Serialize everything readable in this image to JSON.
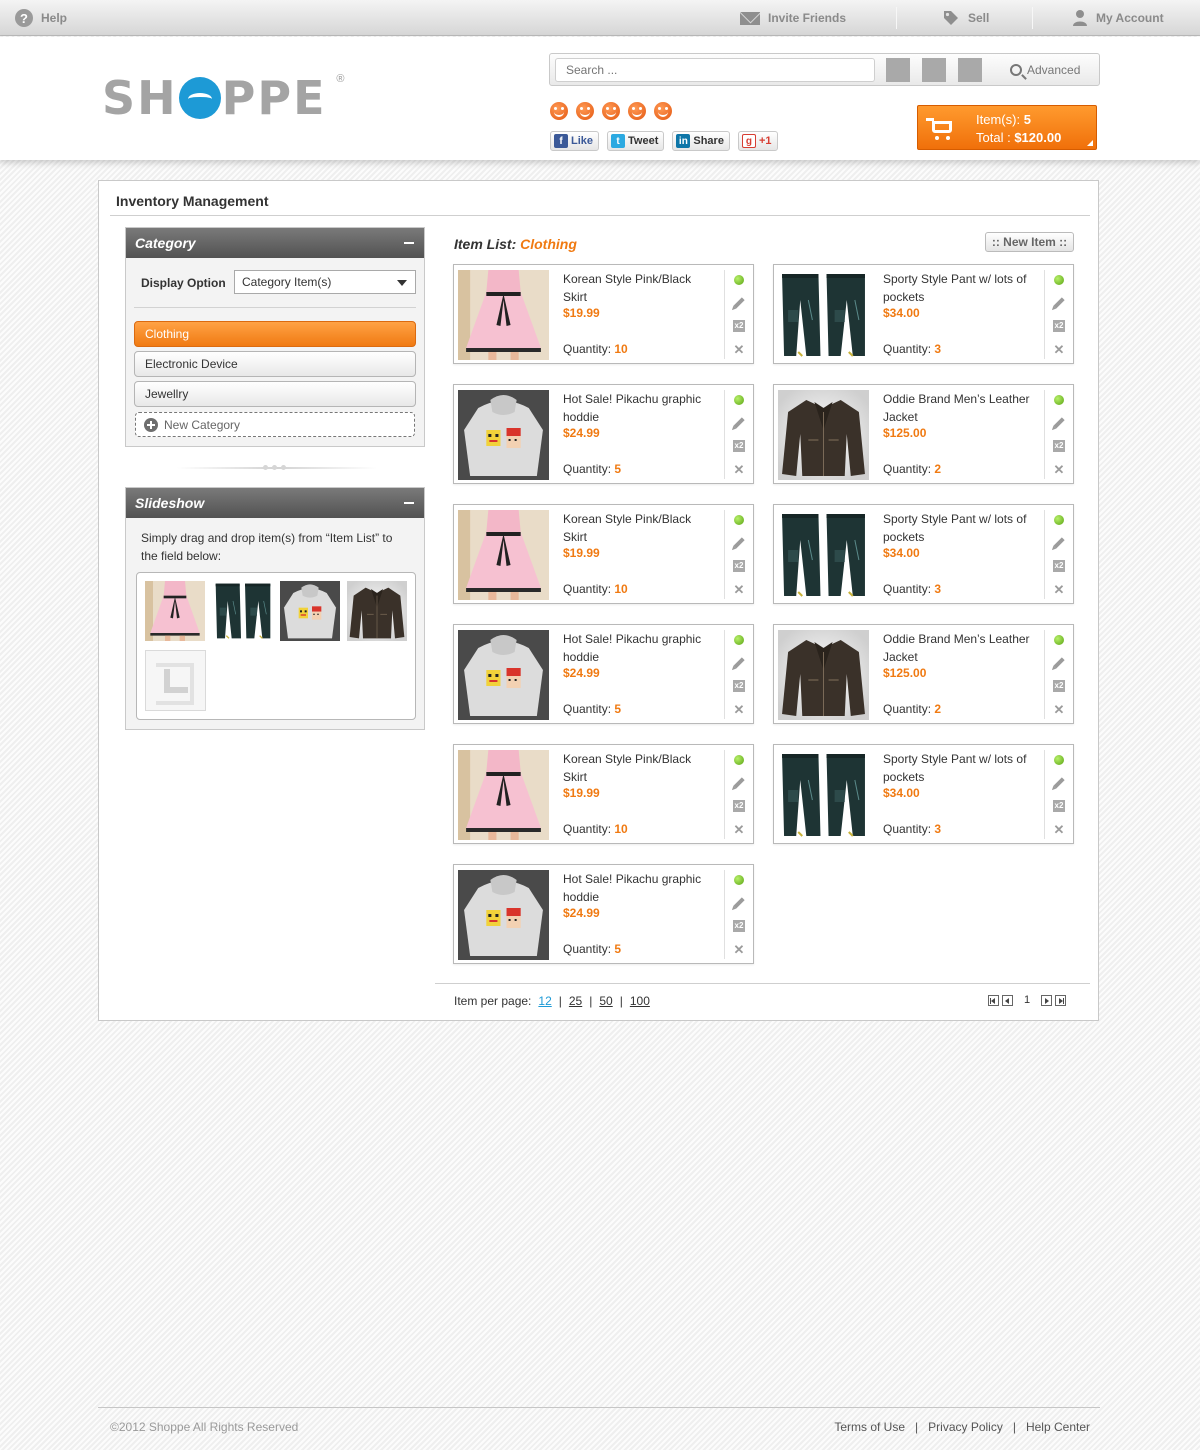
{
  "topbar": {
    "help": "Help",
    "invite": "Invite Friends",
    "sell": "Sell",
    "account": "My Account"
  },
  "header": {
    "logo": {
      "left": "SH",
      "right": "PPE",
      "reg": "®"
    },
    "search": {
      "placeholder": "Search ...",
      "advanced_label": "Advanced"
    },
    "rating_icons": [
      "smiley-icon",
      "smiley-icon",
      "smiley-icon",
      "smiley-icon",
      "smiley-icon"
    ],
    "social": {
      "like": "Like",
      "tweet": "Tweet",
      "share": "Share",
      "plus_one": "+1"
    },
    "cart": {
      "items_label": "Item(s):",
      "items_count": "5",
      "total_label": "Total :",
      "total_value": "$120.00"
    }
  },
  "main": {
    "page_title": "Inventory Management",
    "category_panel": {
      "title": "Category",
      "display_option_label": "Display Option",
      "display_option_value": "Category Item(s)",
      "categories": [
        {
          "label": "Clothing",
          "active": true
        },
        {
          "label": "Electronic Device",
          "active": false
        },
        {
          "label": "Jewellry",
          "active": false
        }
      ],
      "new_category_label": "New Category"
    },
    "slideshow_panel": {
      "title": "Slideshow",
      "description": "Simply drag and drop item(s) from “Item List” to the field below:",
      "thumbs": [
        "skirt",
        "pants",
        "hoodie",
        "jacket"
      ]
    },
    "item_list": {
      "title_label": "Item List:",
      "category": "Clothing",
      "new_item_label": ":: New Item ::",
      "quantity_label": "Quantity:",
      "items": [
        {
          "name": "Korean Style Pink/Black Skirt",
          "price": "$19.99",
          "quantity": "10",
          "image": "skirt"
        },
        {
          "name": "Sporty Style Pant w/ lots of pockets",
          "price": "$34.00",
          "quantity": "3",
          "image": "pants"
        },
        {
          "name": "Hot Sale! Pikachu graphic hoddie",
          "price": "$24.99",
          "quantity": "5",
          "image": "hoodie"
        },
        {
          "name": "Oddie Brand Men’s Leather Jacket",
          "price": "$125.00",
          "quantity": "2",
          "image": "jacket"
        },
        {
          "name": "Korean Style Pink/Black Skirt",
          "price": "$19.99",
          "quantity": "10",
          "image": "skirt"
        },
        {
          "name": "Sporty Style Pant w/ lots of pockets",
          "price": "$34.00",
          "quantity": "3",
          "image": "pants"
        },
        {
          "name": "Hot Sale! Pikachu graphic hoddie",
          "price": "$24.99",
          "quantity": "5",
          "image": "hoodie"
        },
        {
          "name": "Oddie Brand Men’s Leather Jacket",
          "price": "$125.00",
          "quantity": "2",
          "image": "jacket"
        },
        {
          "name": "Korean Style Pink/Black Skirt",
          "price": "$19.99",
          "quantity": "10",
          "image": "skirt"
        },
        {
          "name": "Sporty Style Pant w/ lots of pockets",
          "price": "$34.00",
          "quantity": "3",
          "image": "pants"
        },
        {
          "name": "Hot Sale! Pikachu graphic hoddie",
          "price": "$24.99",
          "quantity": "5",
          "image": "hoodie"
        }
      ]
    },
    "pager": {
      "per_page_label": "Item per page:",
      "options": [
        "12",
        "25",
        "50",
        "100"
      ],
      "current_option": "12",
      "current_page": "1"
    }
  },
  "footer": {
    "copyright": "©2012 Shoppe All Rights Reserved",
    "links": [
      "Terms of Use",
      "Privacy Policy",
      "Help Center"
    ]
  },
  "colors": {
    "accent": "#f07a12",
    "brand_blue": "#1d9ad6",
    "status_green": "#5aa312"
  }
}
